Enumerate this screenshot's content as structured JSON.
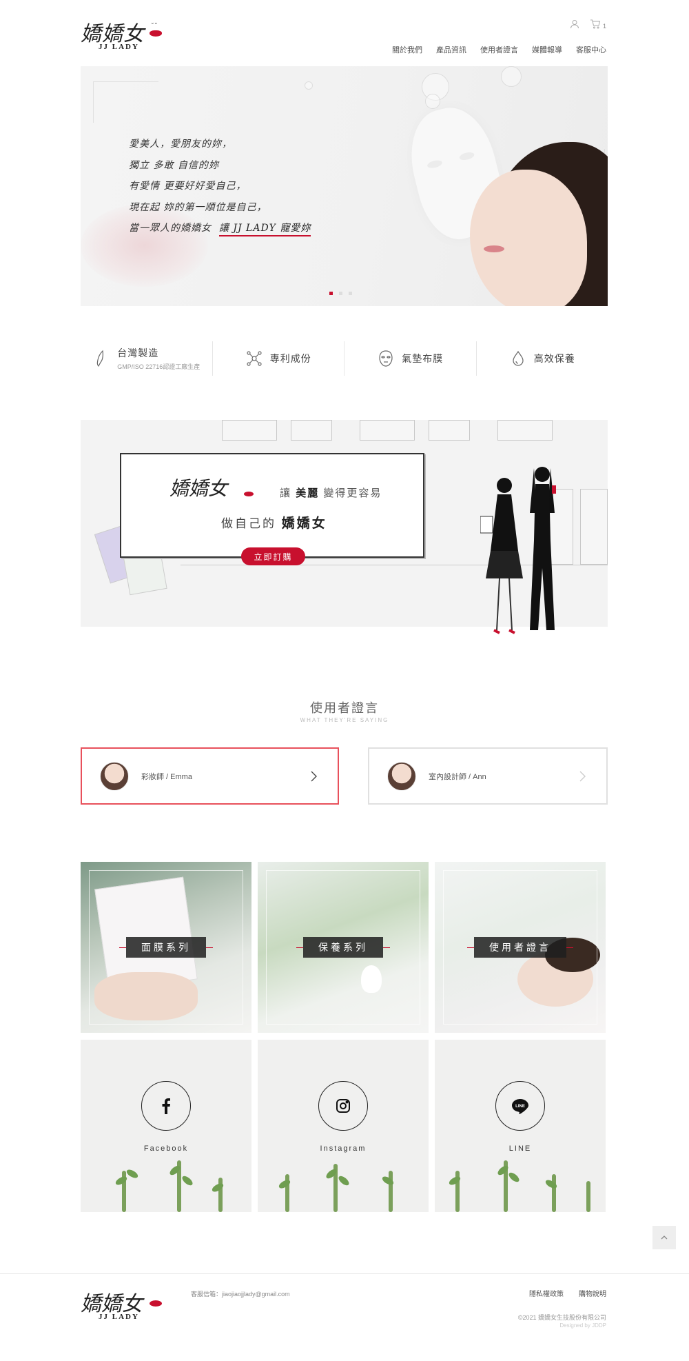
{
  "brand": {
    "logo_script": "嬌嬌女",
    "logo_sub": "JJ LADY"
  },
  "header": {
    "cart_count": "1",
    "nav": [
      "關於我們",
      "產品資訊",
      "使用者證言",
      "媒體報導",
      "客服中心"
    ]
  },
  "hero": {
    "lines": [
      "愛美人，愛朋友的妳，",
      "獨立 多敢 自信的妳",
      "有愛情 更要好好愛自己，",
      "現在起 妳的第一順位是自己，"
    ],
    "last_line_prefix": "當一眾人的嬌嬌女",
    "last_line_emphasis": "讓 JJ LADY 寵愛妳",
    "slides": 3,
    "active_slide": 1
  },
  "features": [
    {
      "icon": "taiwan-map-icon",
      "title": "台灣製造",
      "sub": "GMP/ISO 22716認證工廠生產"
    },
    {
      "icon": "molecule-icon",
      "title": "專利成份",
      "sub": ""
    },
    {
      "icon": "face-mask-icon",
      "title": "氣墊布膜",
      "sub": ""
    },
    {
      "icon": "droplet-icon",
      "title": "高效保養",
      "sub": ""
    }
  ],
  "banner": {
    "logo_script": "嬌嬌女",
    "line1_pre": "讓",
    "line1_bold": "美麗",
    "line1_post": "變得更容易",
    "line2_pre": "做自己的",
    "line2_bold": "嬌嬌女",
    "cta": "立即訂購"
  },
  "testimonials": {
    "title": "使用者證言",
    "subtitle": "WHAT THEY'RE SAYING",
    "items": [
      {
        "name": "彩妝師 / Emma",
        "active": true
      },
      {
        "name": "室內設計師 / Ann",
        "active": false
      }
    ]
  },
  "categories": [
    {
      "label": "面膜系列"
    },
    {
      "label": "保養系列"
    },
    {
      "label": "使用者證言"
    }
  ],
  "social": [
    {
      "label": "Facebook",
      "icon": "facebook-icon"
    },
    {
      "label": "Instagram",
      "icon": "instagram-icon"
    },
    {
      "label": "LINE",
      "icon": "line-icon"
    }
  ],
  "footer": {
    "email": "客服信箱：jiaojiaojjlady@gmail.com",
    "links": [
      "隱私權政策",
      "購物說明"
    ],
    "copyright": "©2021  嬌嬌女生技股份有限公司",
    "designed_by": "Designed by JDDP"
  },
  "colors": {
    "accent": "#c8102e",
    "active_border": "#e8505b"
  }
}
